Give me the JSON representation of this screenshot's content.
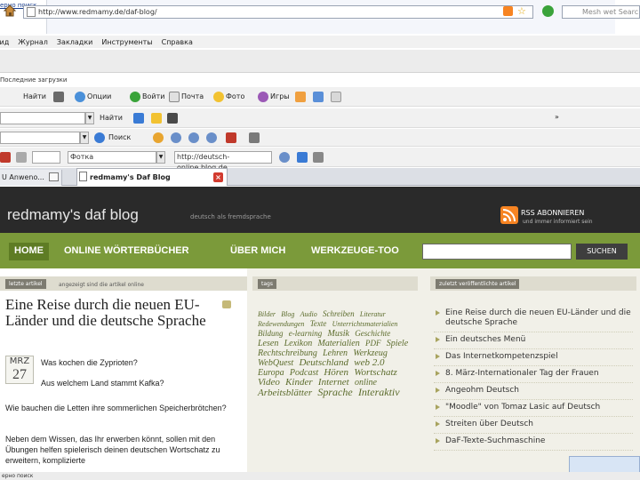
{
  "top": {
    "link": "ерно поиск"
  },
  "menu": [
    "Вид",
    "Журнал",
    "Закладки",
    "Инструменты",
    "Справка"
  ],
  "address": {
    "url": "http://www.redmamy.de/daf-blog/",
    "search_placeholder": "Mesh wet Searc"
  },
  "history_label": "Последние загрузки",
  "toolbar1": [
    "Найти",
    "Опции",
    "Войти",
    "Почта",
    "Фото",
    "Игры"
  ],
  "toolbar2": [
    "Найти"
  ],
  "toolbar3": [
    "Поиск"
  ],
  "toolbar4": {
    "field_value": "Фоткa",
    "url": "http://deutsch-online.blog.de"
  },
  "tabs": [
    {
      "label": "U Anweno..."
    },
    {
      "label": "redmamy's Daf Blog"
    }
  ],
  "blog": {
    "title": "redmamy's daf blog",
    "tagline": "deutsch als fremdsprache",
    "rss_title": "RSS ABONNIEREN",
    "rss_sub": "und immer informiert sein",
    "nav": [
      "HOME",
      "ONLINE WÖRTERBÜCHER",
      "ÜBER MICH",
      "WERKZEUGE-TOO"
    ],
    "search_button": "SUCHEN"
  },
  "left": {
    "pill": "letzte artikel",
    "pill_text": "angezeigt sind die artikel online",
    "article_title": "Eine Reise durch die neuen EU-Länder und die deutsche Sprache",
    "date_month": "MRZ",
    "date_day": "27",
    "line1": "Was kochen die Zyprioten?",
    "line2": "Aus welchem Land stammt Kafka?",
    "line3": "Wie bauchen die Letten ihre sommerlichen Speicherbrötchen?",
    "line4": "Neben dem Wissen, das Ihr erwerben könnt, sollen mit den Übungen helfen spielerisch deinen deutschen Wortschatz zu erweitern, komplizierte"
  },
  "mid": {
    "pill": "tags",
    "tags": [
      {
        "t": "Bilder",
        "s": 8
      },
      {
        "t": "Blog",
        "s": 8
      },
      {
        "t": "Audio",
        "s": 8
      },
      {
        "t": "Schreiben",
        "s": 9
      },
      {
        "t": "Literatur",
        "s": 8
      },
      {
        "t": "Redewendungen",
        "s": 8
      },
      {
        "t": "Texte",
        "s": 9
      },
      {
        "t": "Unterrichtsmaterialien",
        "s": 8
      },
      {
        "t": "Bildung",
        "s": 9
      },
      {
        "t": "e-learning",
        "s": 9
      },
      {
        "t": "Musik",
        "s": 10
      },
      {
        "t": "Geschichte",
        "s": 9
      },
      {
        "t": "Lesen",
        "s": 10
      },
      {
        "t": "Lexikon",
        "s": 10
      },
      {
        "t": "Materialien",
        "s": 10
      },
      {
        "t": "PDF",
        "s": 9
      },
      {
        "t": "Spiele",
        "s": 10
      },
      {
        "t": "Rechtschreibung",
        "s": 10
      },
      {
        "t": "Lehren",
        "s": 10
      },
      {
        "t": "Werkzeug",
        "s": 10
      },
      {
        "t": "WebQuest",
        "s": 10
      },
      {
        "t": "Deutschland",
        "s": 11
      },
      {
        "t": "web 2.0",
        "s": 11
      },
      {
        "t": "Europa",
        "s": 10
      },
      {
        "t": "Podcast",
        "s": 10
      },
      {
        "t": "Hören",
        "s": 11
      },
      {
        "t": "Wortschatz",
        "s": 11
      },
      {
        "t": "Video",
        "s": 11
      },
      {
        "t": "Kinder",
        "s": 11
      },
      {
        "t": "Internet",
        "s": 11
      },
      {
        "t": "online",
        "s": 10
      },
      {
        "t": "Arbeitsblätter",
        "s": 11
      },
      {
        "t": "Sprache",
        "s": 12
      },
      {
        "t": "Interaktiv",
        "s": 12
      }
    ]
  },
  "right": {
    "pill": "zuletzt veröffentlichte artikel",
    "items": [
      "Eine Reise durch die neuen EU-Länder und die deutsche Sprache",
      "Ein deutsches Menü",
      "Das Internetkompetenzspiel",
      "8. März-Internationaler Tag der Frauen",
      "Angeohm Deutsch",
      "\"Moodle\" von Tomaz Lasic auf Deutsch",
      "Streiten über Deutsch",
      "DaF-Texte-Suchmaschine"
    ]
  },
  "status": {
    "text": "ерно поиск"
  },
  "colors": {
    "header": "#2a2a2a",
    "nav": "#7b9a3a",
    "rss": "#f78422"
  }
}
